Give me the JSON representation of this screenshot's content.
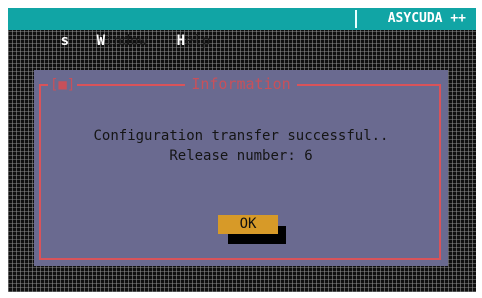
{
  "menubar": {
    "items": [
      {
        "hot": "s",
        "rest": ""
      },
      {
        "hot": "W",
        "rest": "indow"
      },
      {
        "hot": "H",
        "rest": "elp"
      }
    ],
    "brand": "ASYCUDA ++"
  },
  "dialog": {
    "close_glyph": "[■]",
    "title": "Information",
    "message_line1": "Configuration transfer successful..",
    "message_line2": "Release number: 6",
    "ok_label": "OK"
  }
}
